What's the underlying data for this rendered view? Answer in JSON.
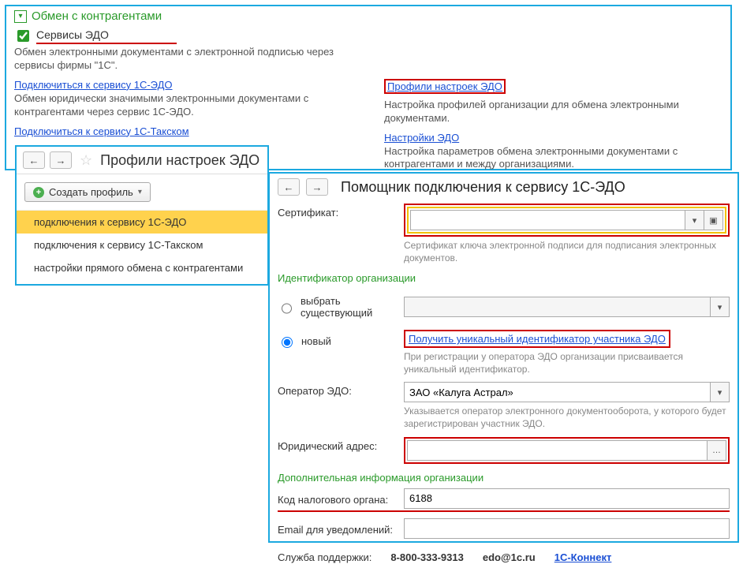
{
  "main": {
    "section_title": "Обмен с контрагентами",
    "checkbox_label": "Сервисы ЭДО",
    "checkbox_checked": true,
    "desc1": "Обмен электронными документами с электронной подписью через сервисы фирмы \"1С\".",
    "left": {
      "link1": "Подключиться к сервису 1С-ЭДО",
      "desc1": "Обмен юридически значимыми электронными документами с контрагентами через сервис 1С-ЭДО.",
      "link2": "Подключиться к сервису 1С-Такском"
    },
    "right": {
      "link1": "Профили настроек ЭДО",
      "desc1": "Настройка профилей организации для обмена электронными документами.",
      "link2": "Настройки ЭДО",
      "desc2": "Настройка параметров обмена электронными документами с контрагентами и между организациями."
    }
  },
  "profiles": {
    "title": "Профили настроек ЭДО",
    "create_btn": "Создать профиль",
    "items": [
      "подключения к сервису 1С-ЭДО",
      "подключения к сервису 1С-Такском",
      "настройки прямого обмена с контрагентами"
    ]
  },
  "wizard": {
    "title": "Помощник подключения к сервису 1С-ЭДО",
    "cert_label": "Сертификат:",
    "cert_value": "",
    "cert_hint": "Сертификат ключа электронной подписи для подписания электронных документов.",
    "org_id_section": "Идентификатор организации",
    "radio_existing": "выбрать существующий",
    "radio_new": "новый",
    "radio_new_selected": true,
    "get_id_link": "Получить уникальный идентификатор участника ЭДО",
    "get_id_hint": "При регистрации у оператора ЭДО организации присваивается уникальный идентификатор.",
    "operator_label": "Оператор ЭДО:",
    "operator_value": "ЗАО «Калуга Астрал»",
    "operator_hint": "Указывается оператор электронного документооборота, у которого будет зарегистрирован участник ЭДО.",
    "address_label": "Юридический адрес:",
    "address_value": "",
    "extra_section": "Дополнительная информация организации",
    "tax_label": "Код налогового органа:",
    "tax_value": "6188",
    "email_label": "Email для уведомлений:",
    "email_value": "",
    "support_label": "Служба поддержки:",
    "support_phone": "8-800-333-9313",
    "support_email": "edo@1c.ru",
    "support_link": "1С-Коннект"
  }
}
